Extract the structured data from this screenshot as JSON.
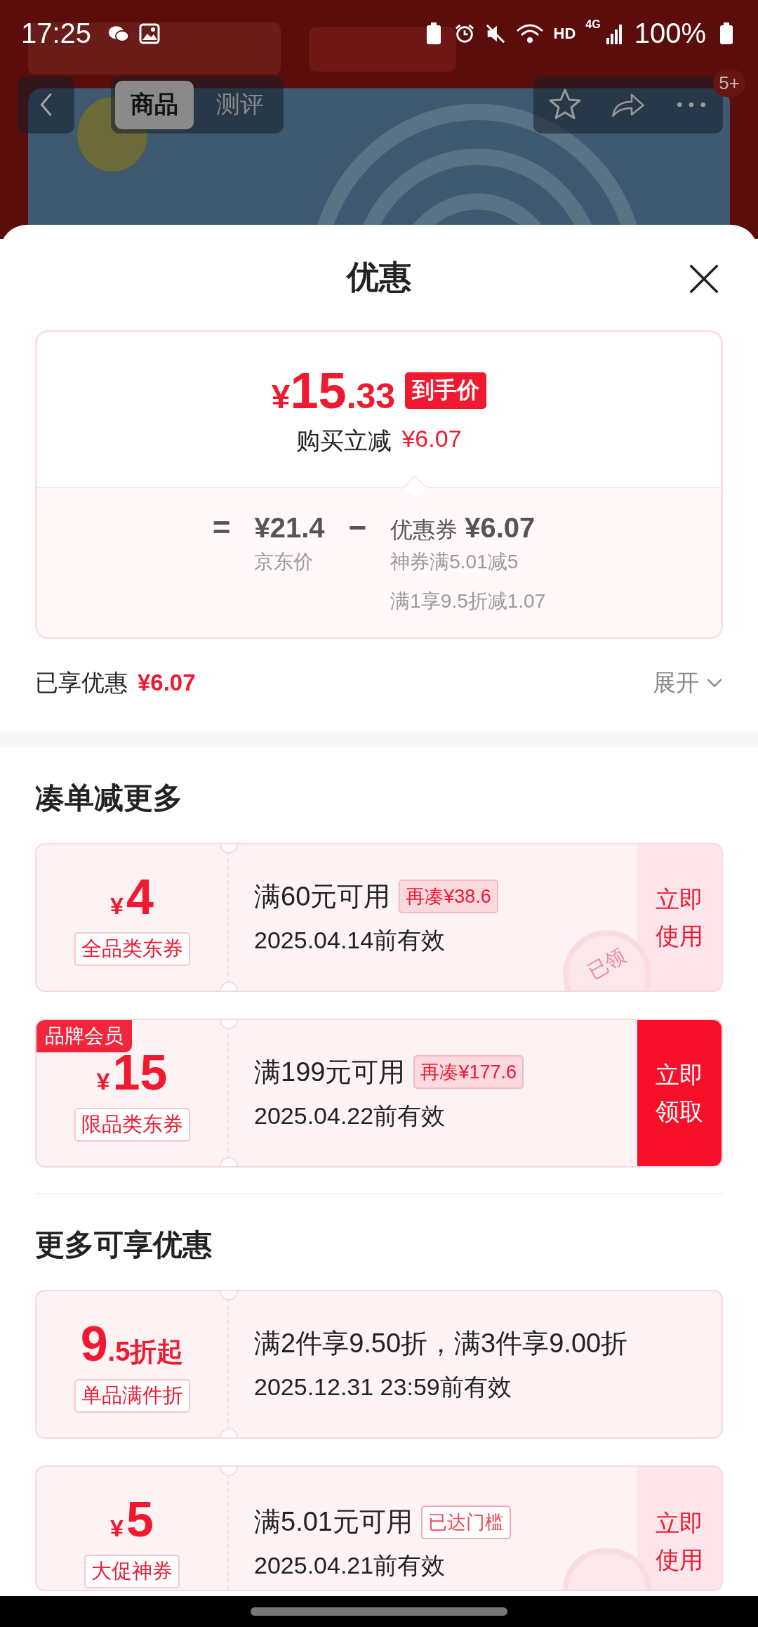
{
  "status_bar": {
    "time": "17:25",
    "network_label": "HD",
    "cell_label": "4G",
    "battery": "100%"
  },
  "header": {
    "tabs": [
      {
        "label": "商品",
        "selected": true
      },
      {
        "label": "测评",
        "selected": false
      }
    ],
    "badge": "5+"
  },
  "sheet": {
    "title": "优惠",
    "price_card": {
      "currency": "¥",
      "price_int": "15",
      "price_dec": ".33",
      "price_tag": "到手价",
      "reduce_label": "购买立减",
      "reduce_amount": "¥6.07",
      "equals": "=",
      "base_price": "¥21.4",
      "base_label": "京东价",
      "minus": "−",
      "coupon_label": "优惠券",
      "coupon_amount": "¥6.07",
      "details": [
        "神券满5.01减5",
        "满1享9.5折减1.07"
      ]
    },
    "saved": {
      "label": "已享优惠",
      "amount": "¥6.07",
      "expand": "展开"
    },
    "sections": [
      {
        "title": "凑单减更多",
        "coupons": [
          {
            "prefix": "¥",
            "value": "4",
            "type": "全品类东券",
            "condition": "满60元可用",
            "badge": {
              "text": "再凑¥38.6",
              "kind": "filled"
            },
            "validity": "2025.04.14前有效",
            "action": {
              "text": "立即使用",
              "highlighted": false
            },
            "claimed": true,
            "stamp_text": "已领"
          },
          {
            "corner": "品牌会员",
            "prefix": "¥",
            "value": "15",
            "type": "限品类东券",
            "condition": "满199元可用",
            "badge": {
              "text": "再凑¥177.6",
              "kind": "filled"
            },
            "validity": "2025.04.22前有效",
            "action": {
              "text": "立即领取",
              "highlighted": true
            },
            "claimed": false
          }
        ]
      },
      {
        "title": "更多可享优惠",
        "coupons": [
          {
            "value": "9",
            "suffix": ".5折起",
            "type": "单品满件折",
            "condition": "满2件享9.50折，满3件享9.00折",
            "validity": "2025.12.31 23:59前有效",
            "claimed": false
          },
          {
            "prefix": "¥",
            "value": "5",
            "type": "大促神券",
            "condition": "满5.01元可用",
            "badge": {
              "text": "已达门槛",
              "kind": "outline"
            },
            "validity": "2025.04.21前有效",
            "action": {
              "text": "立即使用",
              "highlighted": false
            },
            "claimed": true
          }
        ]
      }
    ]
  }
}
